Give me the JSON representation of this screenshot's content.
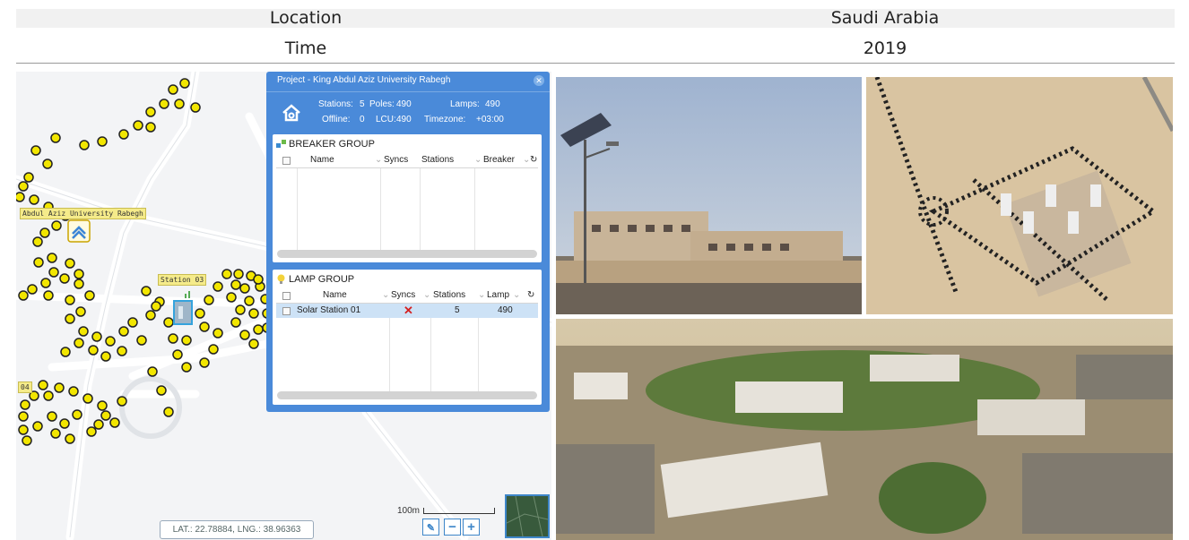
{
  "header": {
    "rows": [
      {
        "label": "Location",
        "value": "Saudi Arabia"
      },
      {
        "label": "Time",
        "value": "2019"
      }
    ]
  },
  "map": {
    "labels": {
      "project": "Abdul Aziz University Rabegh",
      "station_03": "Station 03",
      "station_04": "04"
    },
    "coords": "LAT.: 22.78884, LNG.: 38.96363",
    "scale": "100m",
    "zoom_in": "+",
    "zoom_out": "−",
    "marker_color": "#f2e600",
    "icons": {
      "ruler": "ruler-icon",
      "minimap": "satellite-minimap",
      "home": "home-icon",
      "station": "station-icon"
    }
  },
  "panel": {
    "title": "Project - King Abdul Aziz University Rabegh",
    "stats": {
      "stations_label": "Stations:",
      "stations": "5",
      "poles_label": "Poles:",
      "poles": "490",
      "lamps_label": "Lamps:",
      "lamps": "490",
      "offline_label": "Offline:",
      "offline": "0",
      "lcu_label": "LCU:",
      "lcu": "490",
      "timezone_label": "Timezone:",
      "timezone": "+03:00"
    },
    "breaker_group": {
      "title": "BREAKER GROUP",
      "columns": [
        "Name",
        "Syncs",
        "Stations",
        "Breaker"
      ]
    },
    "lamp_group": {
      "title": "LAMP GROUP",
      "columns": [
        "Name",
        "Syncs",
        "Stations",
        "Lamp"
      ],
      "rows": [
        {
          "name": "Solar Station 01",
          "syncs": "✕",
          "stations": "5",
          "lamp": "490"
        }
      ]
    },
    "accent": "#4a8ad9"
  },
  "photos": {
    "items": [
      "solar-street-light-photo",
      "satellite-aerial-photo",
      "campus-rendering-photo"
    ]
  }
}
